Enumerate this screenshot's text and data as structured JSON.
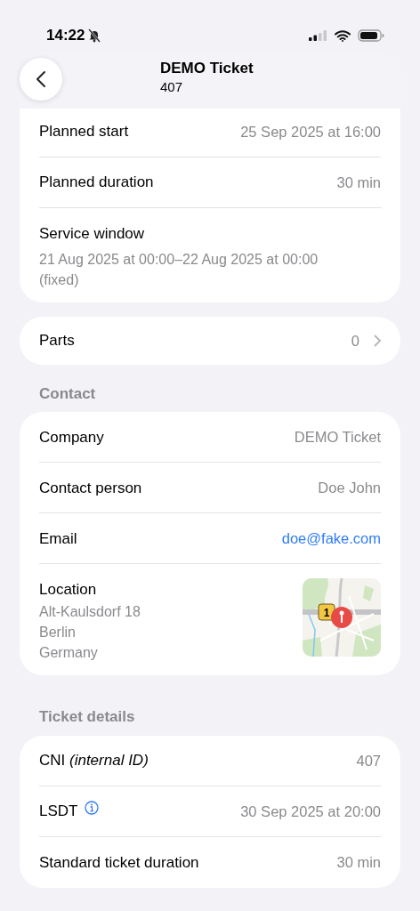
{
  "status_bar": {
    "time": "14:22"
  },
  "header": {
    "title": "DEMO Ticket",
    "subtitle": "407"
  },
  "sections": [
    {
      "rows": [
        {
          "kind": "value",
          "label": "Planned start",
          "value": "25 Sep 2025 at 16:00"
        },
        {
          "kind": "value",
          "label": "Planned duration",
          "value": "30 min"
        },
        {
          "kind": "stacked",
          "label": "Service window",
          "value": "21 Aug 2025 at 00:00–22 Aug 2025 at 00:00 (fixed)"
        }
      ]
    },
    {
      "rows": [
        {
          "kind": "nav",
          "label": "Parts",
          "value": "0"
        }
      ]
    },
    {
      "title": "Contact",
      "rows": [
        {
          "kind": "value",
          "label": "Company",
          "value": "DEMO Ticket"
        },
        {
          "kind": "value",
          "label": "Contact person",
          "value": "Doe John"
        },
        {
          "kind": "link",
          "label": "Email",
          "value": "doe@fake.com"
        },
        {
          "kind": "location",
          "label": "Location",
          "lines": [
            "Alt-Kaulsdorf 18",
            "Berlin",
            "Germany"
          ],
          "map_badge": "1"
        }
      ]
    },
    {
      "title": "Ticket details",
      "rows": [
        {
          "kind": "value",
          "label": "CNI *(internal ID)*",
          "value": "407"
        },
        {
          "kind": "info",
          "label": "LSDT",
          "value": "30 Sep 2025 at 20:00"
        },
        {
          "kind": "value",
          "label": "Standard ticket duration",
          "value": "30 min"
        }
      ]
    }
  ]
}
